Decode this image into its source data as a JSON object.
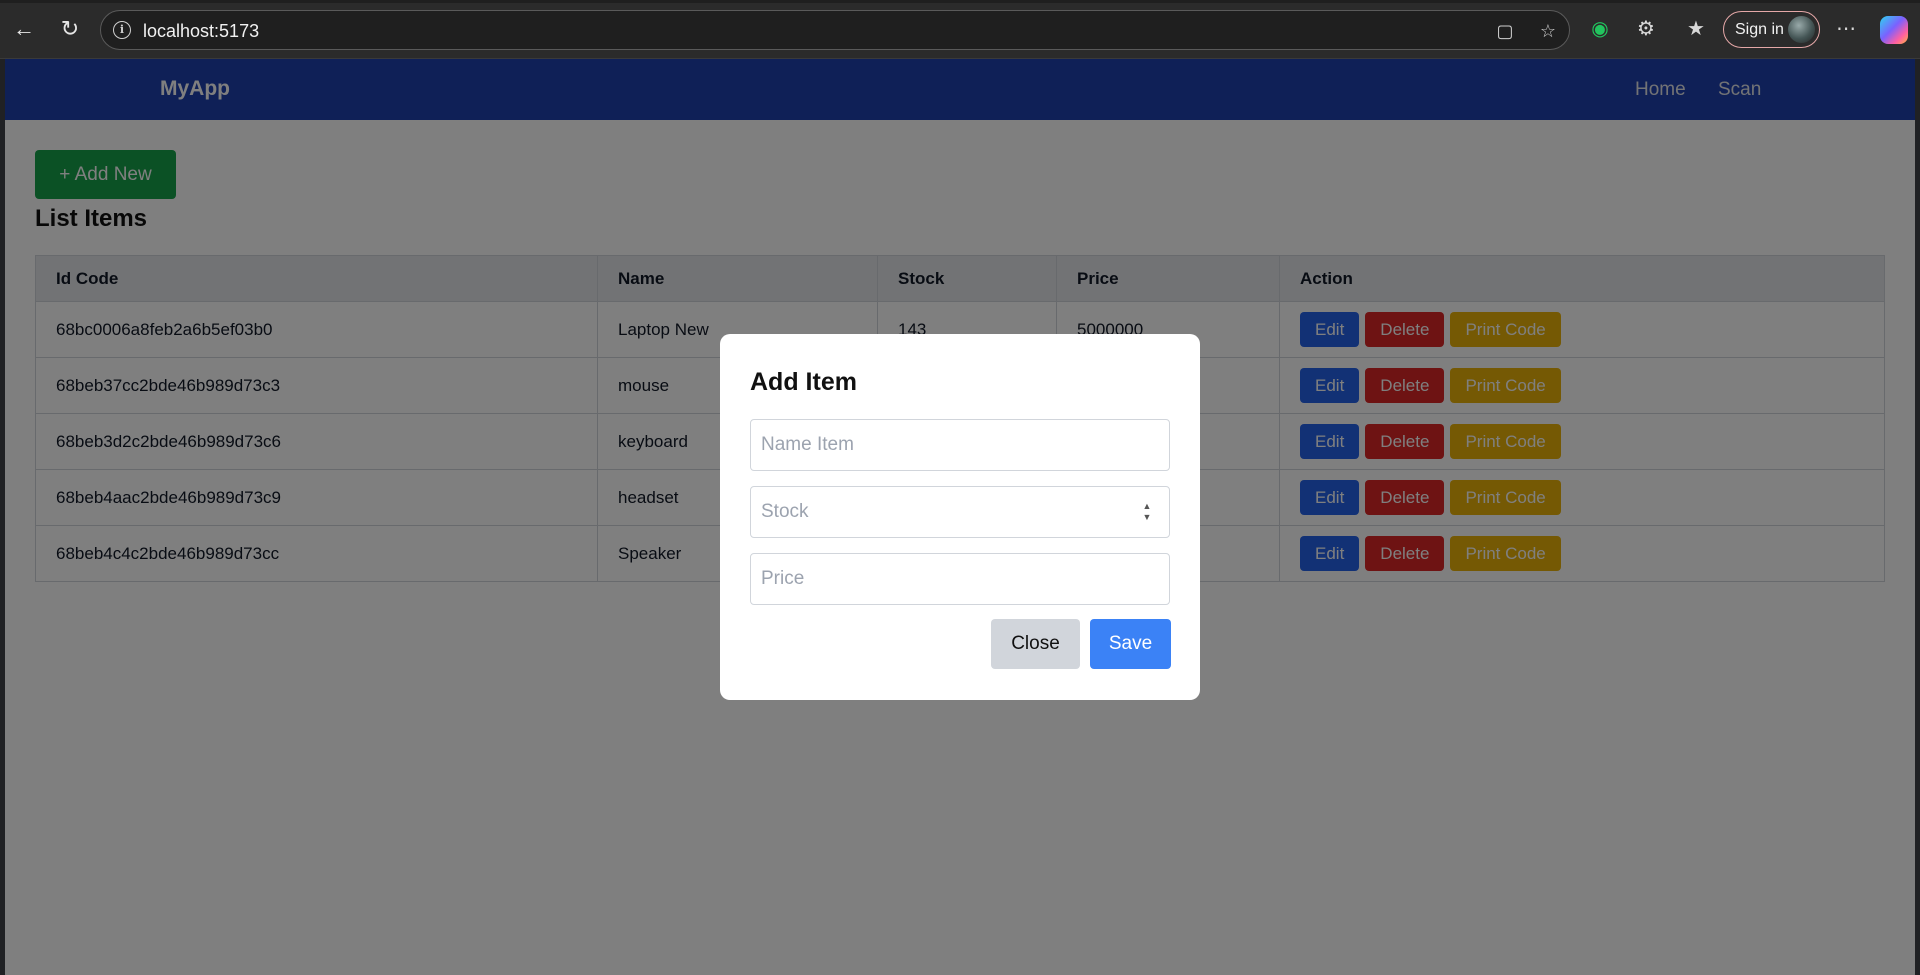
{
  "browser": {
    "url": "localhost:5173",
    "sign_in_label": "Sign in"
  },
  "navbar": {
    "brand": "MyApp",
    "links": [
      "Home",
      "Scan"
    ]
  },
  "page": {
    "add_new_label": "+ Add New",
    "title": "List Items"
  },
  "table": {
    "columns": [
      "Id Code",
      "Name",
      "Stock",
      "Price",
      "Action"
    ],
    "rows": [
      {
        "id": "68bc0006a8feb2a6b5ef03b0",
        "name": "Laptop New",
        "stock": "143",
        "price": "5000000"
      },
      {
        "id": "68beb37cc2bde46b989d73c3",
        "name": "mouse",
        "stock": "",
        "price": ""
      },
      {
        "id": "68beb3d2c2bde46b989d73c6",
        "name": "keyboard",
        "stock": "",
        "price": ""
      },
      {
        "id": "68beb4aac2bde46b989d73c9",
        "name": "headset",
        "stock": "",
        "price": ""
      },
      {
        "id": "68beb4c4c2bde46b989d73cc",
        "name": "Speaker",
        "stock": "",
        "price": ""
      }
    ],
    "actions": {
      "edit": "Edit",
      "delete": "Delete",
      "print": "Print Code"
    }
  },
  "modal": {
    "title": "Add Item",
    "name_placeholder": "Name Item",
    "stock_placeholder": "Stock",
    "price_placeholder": "Price",
    "close_label": "Close",
    "save_label": "Save"
  },
  "colors": {
    "navbar": "#1e40af",
    "add_new": "#16a34a",
    "edit": "#2563eb",
    "delete": "#dc2626",
    "print": "#eab308",
    "save": "#3b82f6"
  }
}
